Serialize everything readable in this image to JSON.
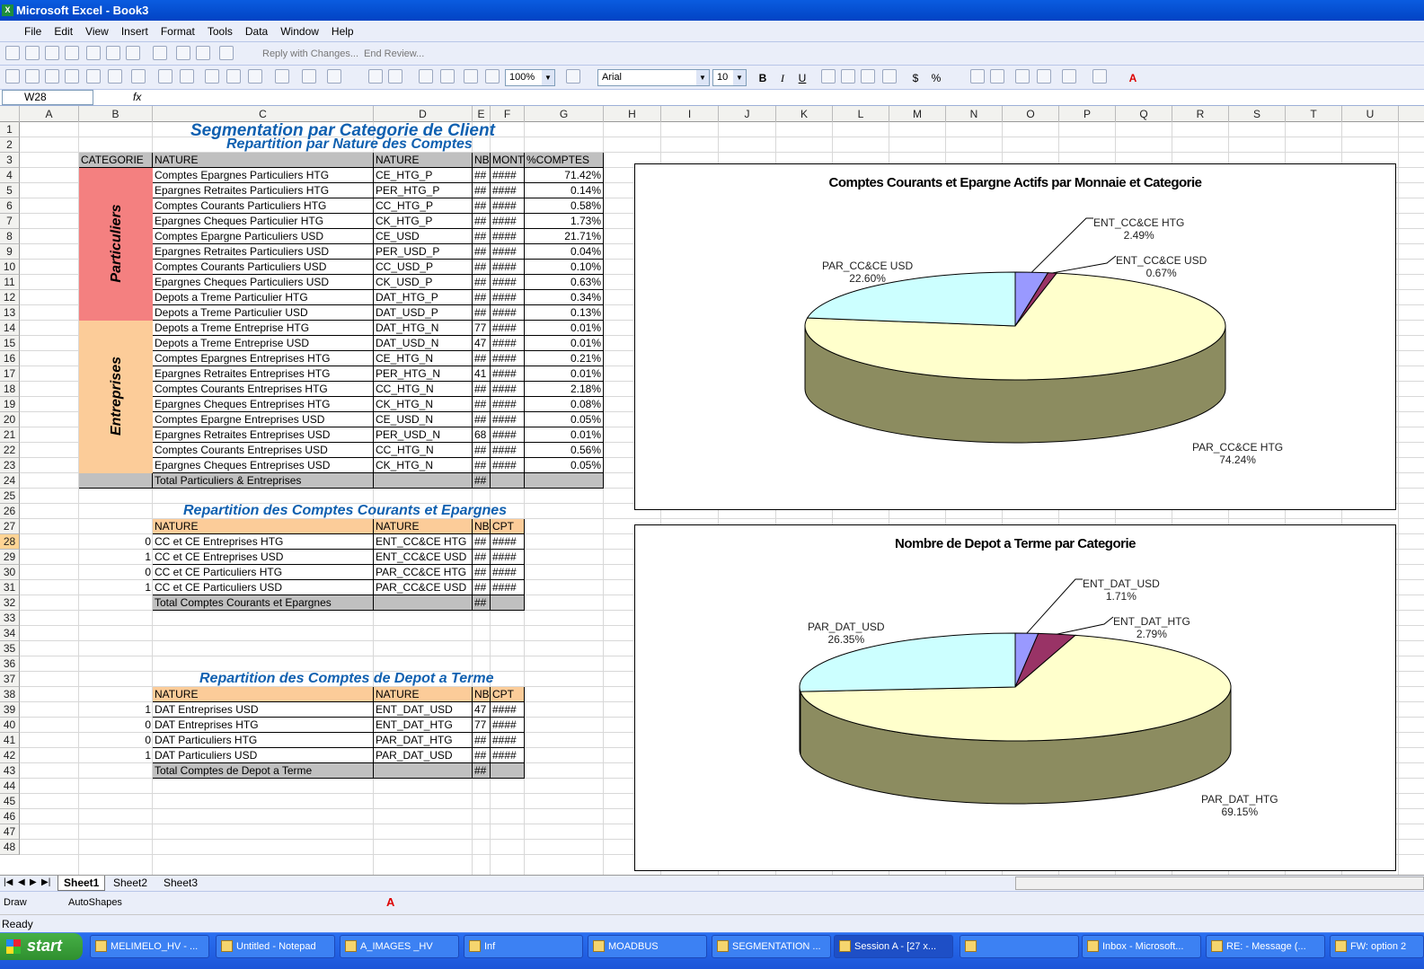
{
  "window": {
    "title": "Microsoft Excel - Book3",
    "app_icon": "excel-icon"
  },
  "menu": [
    "File",
    "Edit",
    "View",
    "Insert",
    "Format",
    "Tools",
    "Data",
    "Window",
    "Help"
  ],
  "toolbar": {
    "reply_label": "Reply with Changes...",
    "end_review_label": "End Review...",
    "zoom": "100%",
    "font": "Arial",
    "font_size": "10"
  },
  "formula_bar": {
    "name_box": "W28",
    "fx": "fx",
    "content": ""
  },
  "columns": [
    "A",
    "B",
    "C",
    "D",
    "E",
    "F",
    "G",
    "H",
    "I",
    "J",
    "K",
    "L",
    "M",
    "N",
    "O",
    "P",
    "Q",
    "R",
    "S",
    "T",
    "U"
  ],
  "rows": [
    "1",
    "2",
    "3",
    "4",
    "5",
    "6",
    "7",
    "8",
    "9",
    "10",
    "11",
    "12",
    "13",
    "14",
    "15",
    "16",
    "17",
    "18",
    "19",
    "20",
    "21",
    "22",
    "23",
    "24",
    "25",
    "26",
    "27",
    "28",
    "29",
    "30",
    "31",
    "32",
    "33",
    "34",
    "35",
    "36",
    "37",
    "38",
    "39",
    "40",
    "41",
    "42",
    "43",
    "44",
    "45",
    "46",
    "47",
    "48"
  ],
  "sheet": {
    "title": "Segmentation  par Categorie de Client",
    "subtitle1": "Repartition par Nature des Comptes",
    "subtitle2": "Repartition des Comptes Courants et Epargnes",
    "subtitle3": "Repartition des Comptes de Depot a Terme",
    "table1": {
      "headers": [
        "CATEGORIE",
        "NATURE",
        "NATURE",
        "NB",
        "MONT",
        "%COMPTES"
      ],
      "cat_particuliers": "Particuliers",
      "cat_entreprises": "Entreprises",
      "rows": [
        {
          "nature": "Comptes Epargnes Particuliers HTG",
          "code": "CE_HTG_P",
          "nb": "##",
          "mont": "####",
          "pct": "71.42%"
        },
        {
          "nature": "Epargnes Retraites Particuliers HTG",
          "code": "PER_HTG_P",
          "nb": "##",
          "mont": "####",
          "pct": "0.14%"
        },
        {
          "nature": "Comptes Courants Particuliers HTG",
          "code": "CC_HTG_P",
          "nb": "##",
          "mont": "####",
          "pct": "0.58%"
        },
        {
          "nature": "Epargnes Cheques Particulier HTG",
          "code": "CK_HTG_P",
          "nb": "##",
          "mont": "####",
          "pct": "1.73%"
        },
        {
          "nature": "Comptes Epargne Particuliers USD",
          "code": "CE_USD",
          "nb": "##",
          "mont": "####",
          "pct": "21.71%"
        },
        {
          "nature": "Epargnes Retraites Particuliers USD",
          "code": "PER_USD_P",
          "nb": "##",
          "mont": "####",
          "pct": "0.04%"
        },
        {
          "nature": "Comptes Courants Particuliers USD",
          "code": "CC_USD_P",
          "nb": "##",
          "mont": "####",
          "pct": "0.10%"
        },
        {
          "nature": "Epargnes Cheques Particuliers USD",
          "code": "CK_USD_P",
          "nb": "##",
          "mont": "####",
          "pct": "0.63%"
        },
        {
          "nature": "Depots a Treme Particulier HTG",
          "code": "DAT_HTG_P",
          "nb": "##",
          "mont": "####",
          "pct": "0.34%"
        },
        {
          "nature": "Depots a Treme Particulier USD",
          "code": "DAT_USD_P",
          "nb": "##",
          "mont": "####",
          "pct": "0.13%"
        },
        {
          "nature": "Depots a Treme Entreprise HTG",
          "code": "DAT_HTG_N",
          "nb": "77",
          "mont": "####",
          "pct": "0.01%"
        },
        {
          "nature": "Depots a Treme Entreprise USD",
          "code": "DAT_USD_N",
          "nb": "47",
          "mont": "####",
          "pct": "0.01%"
        },
        {
          "nature": "Comptes Epargnes Entreprises HTG",
          "code": "CE_HTG_N",
          "nb": "##",
          "mont": "####",
          "pct": "0.21%"
        },
        {
          "nature": "Epargnes Retraites Entreprises HTG",
          "code": "PER_HTG_N",
          "nb": "41",
          "mont": "####",
          "pct": "0.01%"
        },
        {
          "nature": "Comptes Courants Entreprises HTG",
          "code": "CC_HTG_N",
          "nb": "##",
          "mont": "####",
          "pct": "2.18%"
        },
        {
          "nature": "Epargnes Cheques Entreprises HTG",
          "code": "CK_HTG_N",
          "nb": "##",
          "mont": "####",
          "pct": "0.08%"
        },
        {
          "nature": "Comptes Epargne Entreprises USD",
          "code": "CE_USD_N",
          "nb": "##",
          "mont": "####",
          "pct": "0.05%"
        },
        {
          "nature": "Epargnes Retraites Entreprises USD",
          "code": "PER_USD_N",
          "nb": "68",
          "mont": "####",
          "pct": "0.01%"
        },
        {
          "nature": "Comptes Courants Entreprises USD",
          "code": "CC_HTG_N",
          "nb": "##",
          "mont": "####",
          "pct": "0.56%"
        },
        {
          "nature": "Epargnes Cheques Entreprises USD",
          "code": "CK_HTG_N",
          "nb": "##",
          "mont": "####",
          "pct": "0.05%"
        }
      ],
      "total": {
        "label": "Total Particuliers & Entreprises",
        "nb": "##"
      }
    },
    "table2": {
      "headers": [
        "NATURE",
        "NATURE",
        "NB",
        "CPT"
      ],
      "rows": [
        {
          "b": "0",
          "nature": "CC et CE Entreprises HTG",
          "code": "ENT_CC&CE HTG",
          "nb": "##",
          "cpt": "####"
        },
        {
          "b": "1",
          "nature": "CC et CE Entreprises USD",
          "code": "ENT_CC&CE USD",
          "nb": "##",
          "cpt": "####"
        },
        {
          "b": "0",
          "nature": "CC et CE Particuliers HTG",
          "code": "PAR_CC&CE HTG",
          "nb": "##",
          "cpt": "####"
        },
        {
          "b": "1",
          "nature": "CC et CE Particuliers USD",
          "code": "PAR_CC&CE USD",
          "nb": "##",
          "cpt": "####"
        }
      ],
      "total": {
        "label": "Total Comptes Courants et Epargnes",
        "nb": "##"
      }
    },
    "table3": {
      "headers": [
        "NATURE",
        "NATURE",
        "NB",
        "CPT"
      ],
      "rows": [
        {
          "b": "1",
          "nature": "DAT Entreprises USD",
          "code": "ENT_DAT_USD",
          "nb": "47",
          "cpt": "####"
        },
        {
          "b": "0",
          "nature": "DAT Entreprises HTG",
          "code": "ENT_DAT_HTG",
          "nb": "77",
          "cpt": "####"
        },
        {
          "b": "0",
          "nature": "DAT Particuliers HTG",
          "code": "PAR_DAT_HTG",
          "nb": "##",
          "cpt": "####"
        },
        {
          "b": "1",
          "nature": "DAT Particuliers  USD",
          "code": "PAR_DAT_USD",
          "nb": "##",
          "cpt": "####"
        }
      ],
      "total": {
        "label": "Total Comptes de Depot a Terme",
        "nb": "##"
      }
    }
  },
  "chart_data": [
    {
      "type": "pie",
      "title": "Comptes Courants et Epargne Actifs par Monnaie et Categorie",
      "slices": [
        {
          "label": "ENT_CC&CE HTG",
          "value": 2.49,
          "display": "2.49%",
          "color": "#9999ff"
        },
        {
          "label": "ENT_CC&CE USD",
          "value": 0.67,
          "display": "0.67%",
          "color": "#993366"
        },
        {
          "label": "PAR_CC&CE HTG",
          "value": 74.24,
          "display": "74.24%",
          "color": "#ffffcc"
        },
        {
          "label": "PAR_CC&CE USD",
          "value": 22.6,
          "display": "22.60%",
          "color": "#ccffff"
        }
      ]
    },
    {
      "type": "pie",
      "title": "Nombre de Depot a Terme par Categorie",
      "slices": [
        {
          "label": "ENT_DAT_USD",
          "value": 1.71,
          "display": "1.71%",
          "color": "#9999ff"
        },
        {
          "label": "ENT_DAT_HTG",
          "value": 2.79,
          "display": "2.79%",
          "color": "#993366"
        },
        {
          "label": "PAR_DAT_HTG",
          "value": 69.15,
          "display": "69.15%",
          "color": "#ffffcc"
        },
        {
          "label": "PAR_DAT_USD",
          "value": 26.35,
          "display": "26.35%",
          "color": "#ccffff"
        }
      ]
    }
  ],
  "sheet_tabs": [
    "Sheet1",
    "Sheet2",
    "Sheet3"
  ],
  "drawbar": {
    "draw": "Draw",
    "autoshapes": "AutoShapes"
  },
  "status": "Ready",
  "taskbar": {
    "start": "start",
    "items": [
      "MELIMELO_HV - ...",
      "Untitled - Notepad",
      "A_IMAGES _HV",
      "Inf",
      "MOADBUS",
      "SEGMENTATION ...",
      "Session A - [27 x...",
      "",
      "Inbox - Microsoft...",
      "RE: - Message (...",
      "FW: option 2"
    ]
  }
}
